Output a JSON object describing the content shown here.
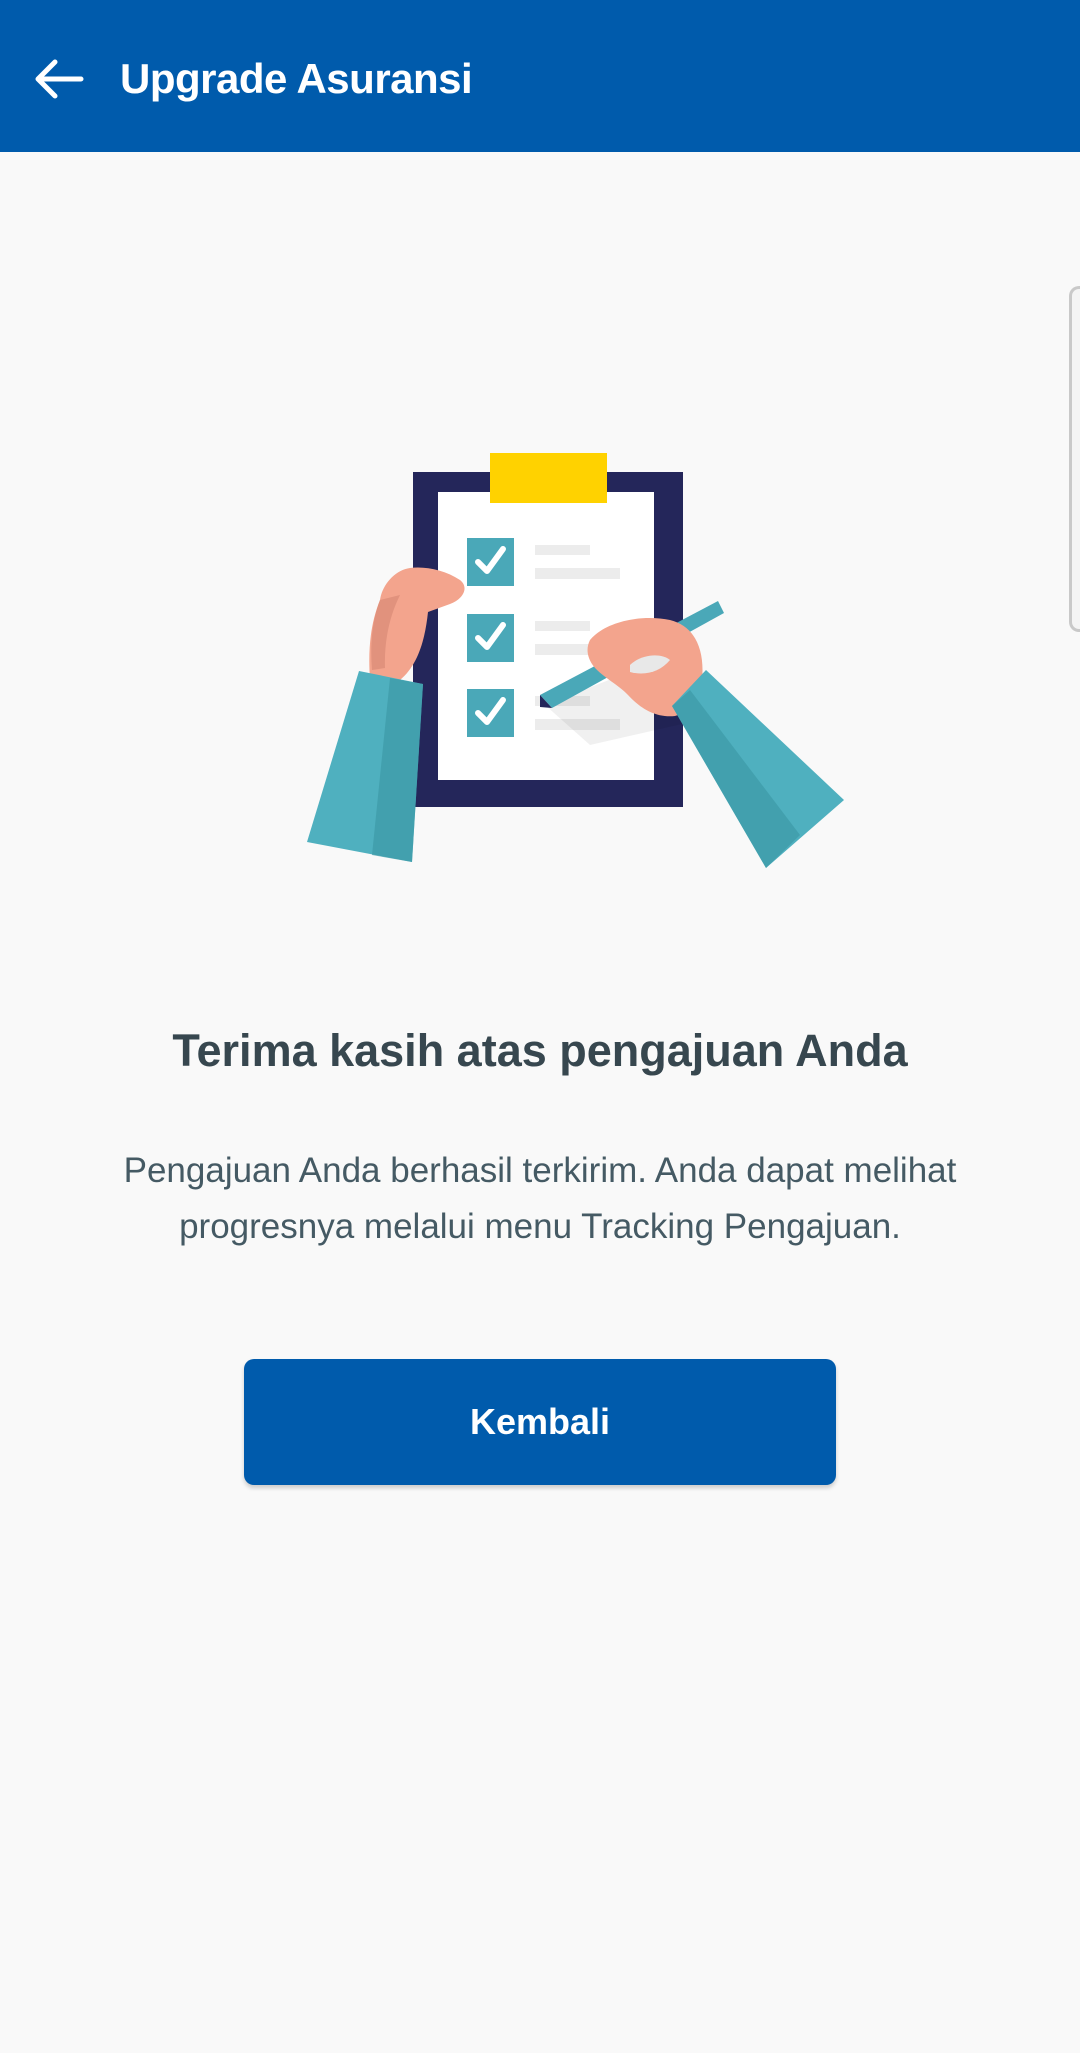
{
  "appbar": {
    "title": "Upgrade Asuransi",
    "back_icon": "arrow-left-icon",
    "background_color": "#005bac"
  },
  "illustration": {
    "icon": "clipboard-checklist-illustration"
  },
  "content": {
    "heading": "Terima kasih atas pengajuan Anda",
    "message": "Pengajuan Anda berhasil terkirim. Anda dapat melihat progresnya melalui menu Tracking Pengajuan."
  },
  "actions": {
    "back_label": "Kembali",
    "button_color": "#005bac"
  },
  "colors": {
    "text_primary": "#37474f",
    "clipboard_frame": "#24265a",
    "clip": "#ffd200",
    "check_box": "#4aa8b8",
    "sleeve": "#4fb0bf",
    "skin": "#f3a48d"
  }
}
